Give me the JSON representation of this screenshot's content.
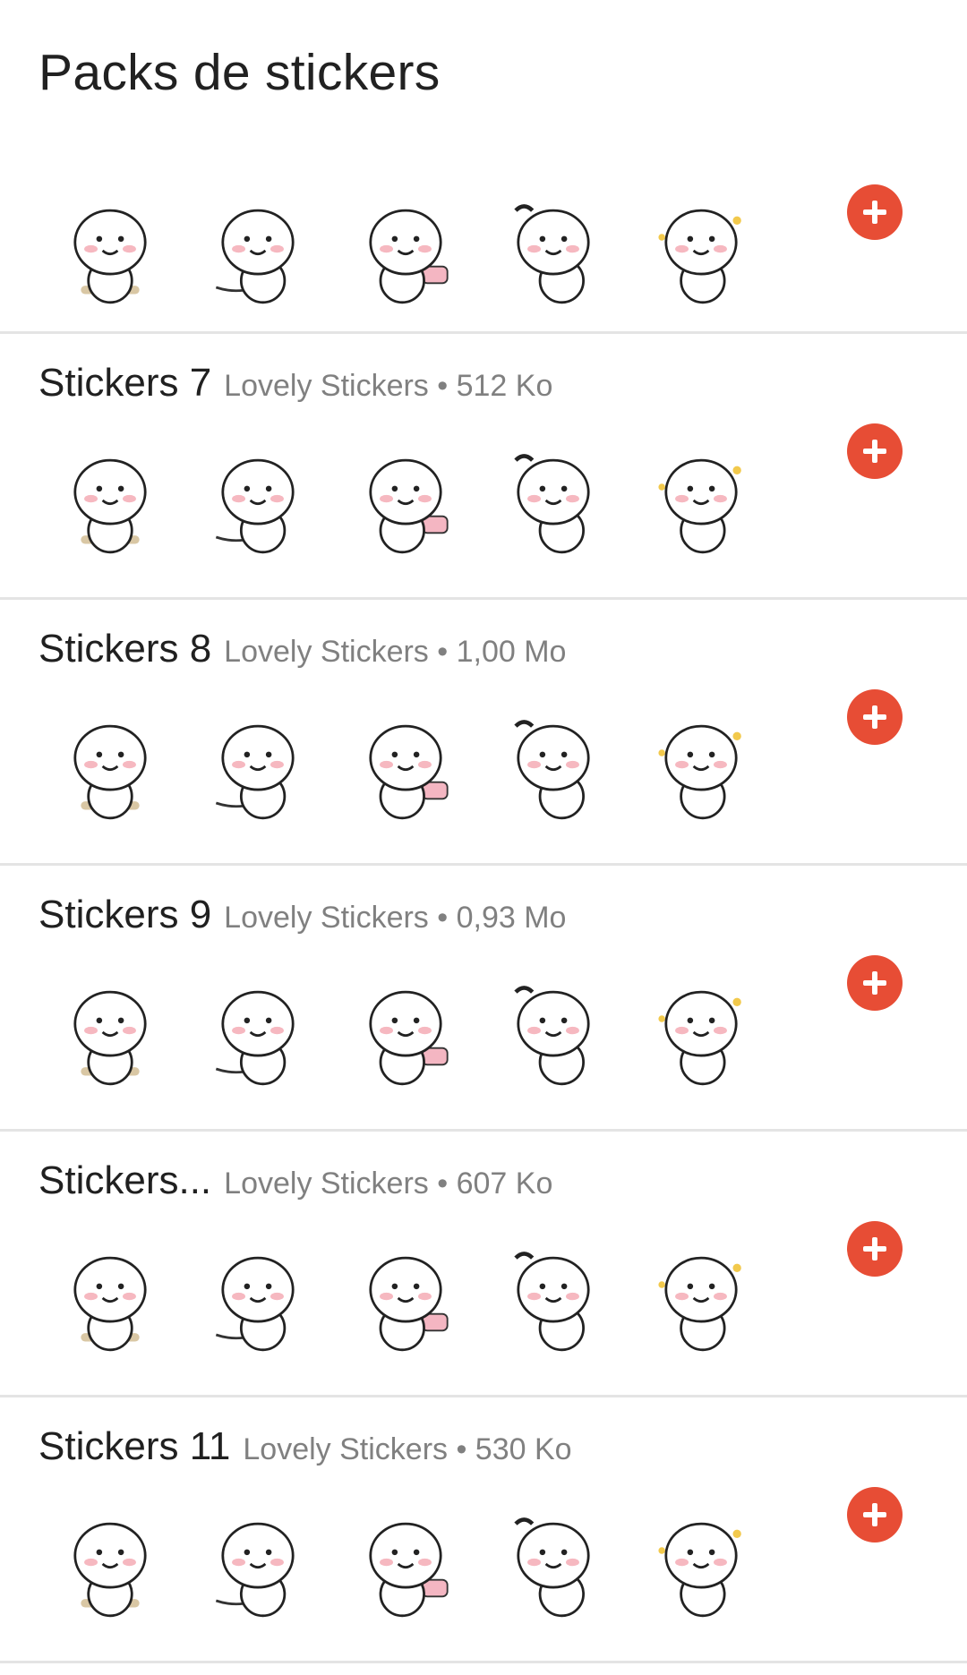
{
  "header": {
    "title": "Packs de stickers"
  },
  "packs": [
    {
      "name": "",
      "meta": "",
      "stickers": [
        "helmet-scooter-sticker",
        "lounging-sticker",
        "lounging-sticker-2",
        "lying-sticker",
        "love-sticker"
      ]
    },
    {
      "name": "Stickers 7",
      "meta": "Lovely Stickers • 512 Ko",
      "stickers": [
        "phone-call-sticker",
        "tv-sticker",
        "lounging-sticker",
        "pillow-sticker",
        "bunny-hat-sticker"
      ]
    },
    {
      "name": "Stickers 8",
      "meta": "Lovely Stickers • 1,00 Mo",
      "stickers": [
        "laugh-sticker",
        "yes-sir-sticker",
        "no-megaphone-sticker",
        "thinking-sticker",
        "hug-sticker"
      ]
    },
    {
      "name": "Stickers 9",
      "meta": "Lovely Stickers • 0,93 Mo",
      "stickers": [
        "headphones-sticker",
        "sparkle-sticker",
        "stool-sticker",
        "shy-sticker",
        "popcorn-sticker"
      ]
    },
    {
      "name": "Stickers...",
      "meta": "Lovely Stickers • 607 Ko",
      "stickers": [
        "kiss-sticker",
        "small-sticker",
        "sleepy-sticker",
        "stool-sad-sticker",
        "smile-sticker"
      ]
    },
    {
      "name": "Stickers 11",
      "meta": "Lovely Stickers • 530 Ko",
      "stickers": [
        "headphones-sticker",
        "peek-heart-sticker",
        "keyboard-sticker",
        "blanket-sticker",
        "cushion-sticker"
      ]
    }
  ],
  "icons": {
    "add": "plus-icon"
  },
  "colors": {
    "accent": "#e74d35",
    "divider": "#e4e4e4"
  }
}
